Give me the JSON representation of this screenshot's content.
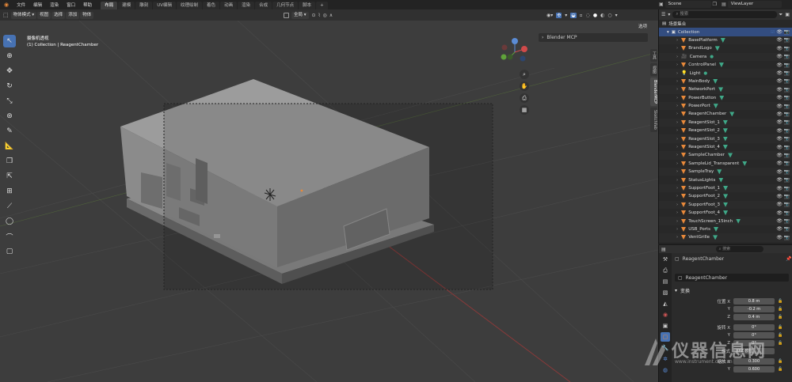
{
  "menubar": {
    "items": [
      "文件",
      "编辑",
      "渲染",
      "窗口",
      "帮助"
    ],
    "workspace_tabs": [
      "布局",
      "建模",
      "雕刻",
      "UV编辑",
      "纹理绘制",
      "着色",
      "动画",
      "渲染",
      "合成",
      "几何节点",
      "脚本"
    ],
    "active_tab_index": 0,
    "scene": "Scene",
    "view_layer": "ViewLayer"
  },
  "viewport_header": {
    "mode": "物体模式",
    "menus": [
      "视图",
      "选择",
      "添加",
      "物体"
    ],
    "transform_orientation": "全局",
    "options_label": "选项"
  },
  "viewport": {
    "view_name": "摄像机透视",
    "collection_info": "(1) Collection | ReagentChamber",
    "panel_title": "Blender MCP",
    "side_tabs": [
      "工具",
      "视图",
      "BlenderMCP",
      "Sketchfab"
    ]
  },
  "outliner": {
    "search_placeholder": "搜索",
    "root": "场景集合",
    "collection": "Collection",
    "objects": [
      {
        "name": "BasePlatform",
        "kind": "mesh"
      },
      {
        "name": "BrandLogo",
        "kind": "mesh"
      },
      {
        "name": "Camera",
        "kind": "camera"
      },
      {
        "name": "ControlPanel",
        "kind": "mesh"
      },
      {
        "name": "Light",
        "kind": "light"
      },
      {
        "name": "MainBody",
        "kind": "mesh"
      },
      {
        "name": "NetworkPort",
        "kind": "mesh"
      },
      {
        "name": "PowerButton",
        "kind": "mesh"
      },
      {
        "name": "PowerPort",
        "kind": "mesh"
      },
      {
        "name": "ReagentChamber",
        "kind": "mesh"
      },
      {
        "name": "ReagentSlot_1",
        "kind": "mesh"
      },
      {
        "name": "ReagentSlot_2",
        "kind": "mesh"
      },
      {
        "name": "ReagentSlot_3",
        "kind": "mesh"
      },
      {
        "name": "ReagentSlot_4",
        "kind": "mesh"
      },
      {
        "name": "SampleChamber",
        "kind": "mesh"
      },
      {
        "name": "SampleLid_Transparent",
        "kind": "mesh"
      },
      {
        "name": "SampleTray",
        "kind": "mesh"
      },
      {
        "name": "StatusLights",
        "kind": "mesh"
      },
      {
        "name": "SupportFoot_1",
        "kind": "mesh"
      },
      {
        "name": "SupportFoot_2",
        "kind": "mesh"
      },
      {
        "name": "SupportFoot_3",
        "kind": "mesh"
      },
      {
        "name": "SupportFoot_4",
        "kind": "mesh"
      },
      {
        "name": "TouchScreen_15inch",
        "kind": "mesh"
      },
      {
        "name": "USB_Ports",
        "kind": "mesh"
      },
      {
        "name": "VentGrille",
        "kind": "mesh"
      }
    ]
  },
  "properties": {
    "search_placeholder": "搜索",
    "object_name": "ReagentChamber",
    "name_field": "ReagentChamber",
    "section": "变换",
    "location_label": "位置 X",
    "location": {
      "x": "0.8 m",
      "y": "-0.2 m",
      "z": "0.4 m"
    },
    "rotation_label": "旋转 X",
    "rotation": {
      "x": "0°",
      "y": "0°",
      "z": "0°"
    },
    "mode_label": "模式",
    "mode_value": "XYZ 欧拉",
    "scale_label": "缩放 X",
    "scale": {
      "x": "0.300",
      "y": "0.600"
    },
    "axis_y": "Y",
    "axis_z": "Z"
  },
  "watermark": {
    "text": "仪器信息网",
    "url": "www.instrument.com.cn"
  },
  "colors": {
    "accent": "#4772b3",
    "object_orange": "#e8893a",
    "modifier_teal": "#3fa888",
    "selected_row": "#334d80"
  }
}
